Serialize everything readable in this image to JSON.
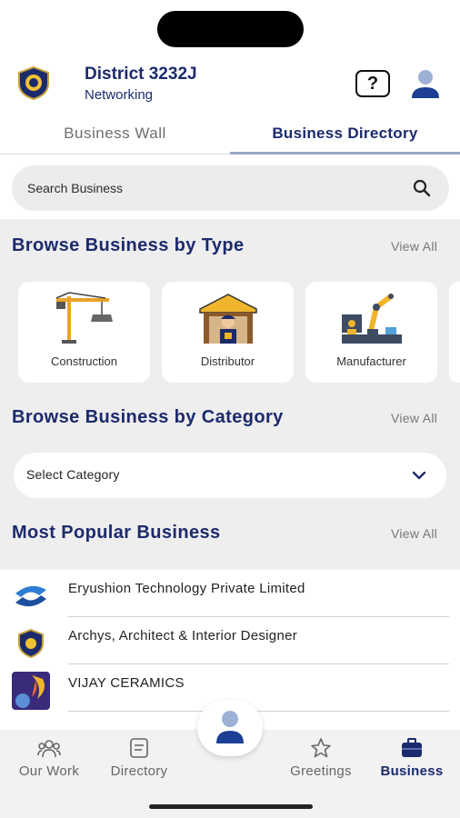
{
  "header": {
    "title": "District 3232J",
    "subtitle": "Networking",
    "help_icon": "question-box-icon",
    "profile_icon": "user-icon"
  },
  "tabs": [
    {
      "label": "Business Wall",
      "active": false
    },
    {
      "label": "Business Directory",
      "active": true
    }
  ],
  "search": {
    "placeholder": "Search Business"
  },
  "browse_type": {
    "title": "Browse Business by Type",
    "view_all": "View All",
    "items": [
      {
        "label": "Construction",
        "icon": "crane-icon"
      },
      {
        "label": "Distributor",
        "icon": "warehouse-worker-icon"
      },
      {
        "label": "Manufacturer",
        "icon": "robot-arm-icon"
      }
    ]
  },
  "browse_category": {
    "title": "Browse Business by Category",
    "view_all": "View All",
    "select_label": "Select Category"
  },
  "popular": {
    "title": "Most Popular Business",
    "view_all": "View All",
    "items": [
      {
        "name": "Eryushion Technology Private Limited"
      },
      {
        "name": "Archys, Architect & Interior Designer"
      },
      {
        "name": "VIJAY CERAMICS"
      }
    ]
  },
  "bottom_nav": {
    "items": [
      {
        "label": "Our Work",
        "icon": "people-icon",
        "active": false
      },
      {
        "label": "Directory",
        "icon": "book-icon",
        "active": false
      },
      {
        "label": "Greetings",
        "icon": "star-icon",
        "active": false
      },
      {
        "label": "Business",
        "icon": "briefcase-icon",
        "active": true
      }
    ],
    "center_icon": "user-icon"
  },
  "colors": {
    "primary": "#1c2a6d",
    "background_grey": "#eeeeee",
    "accent_blue": "#3d5aa8"
  }
}
